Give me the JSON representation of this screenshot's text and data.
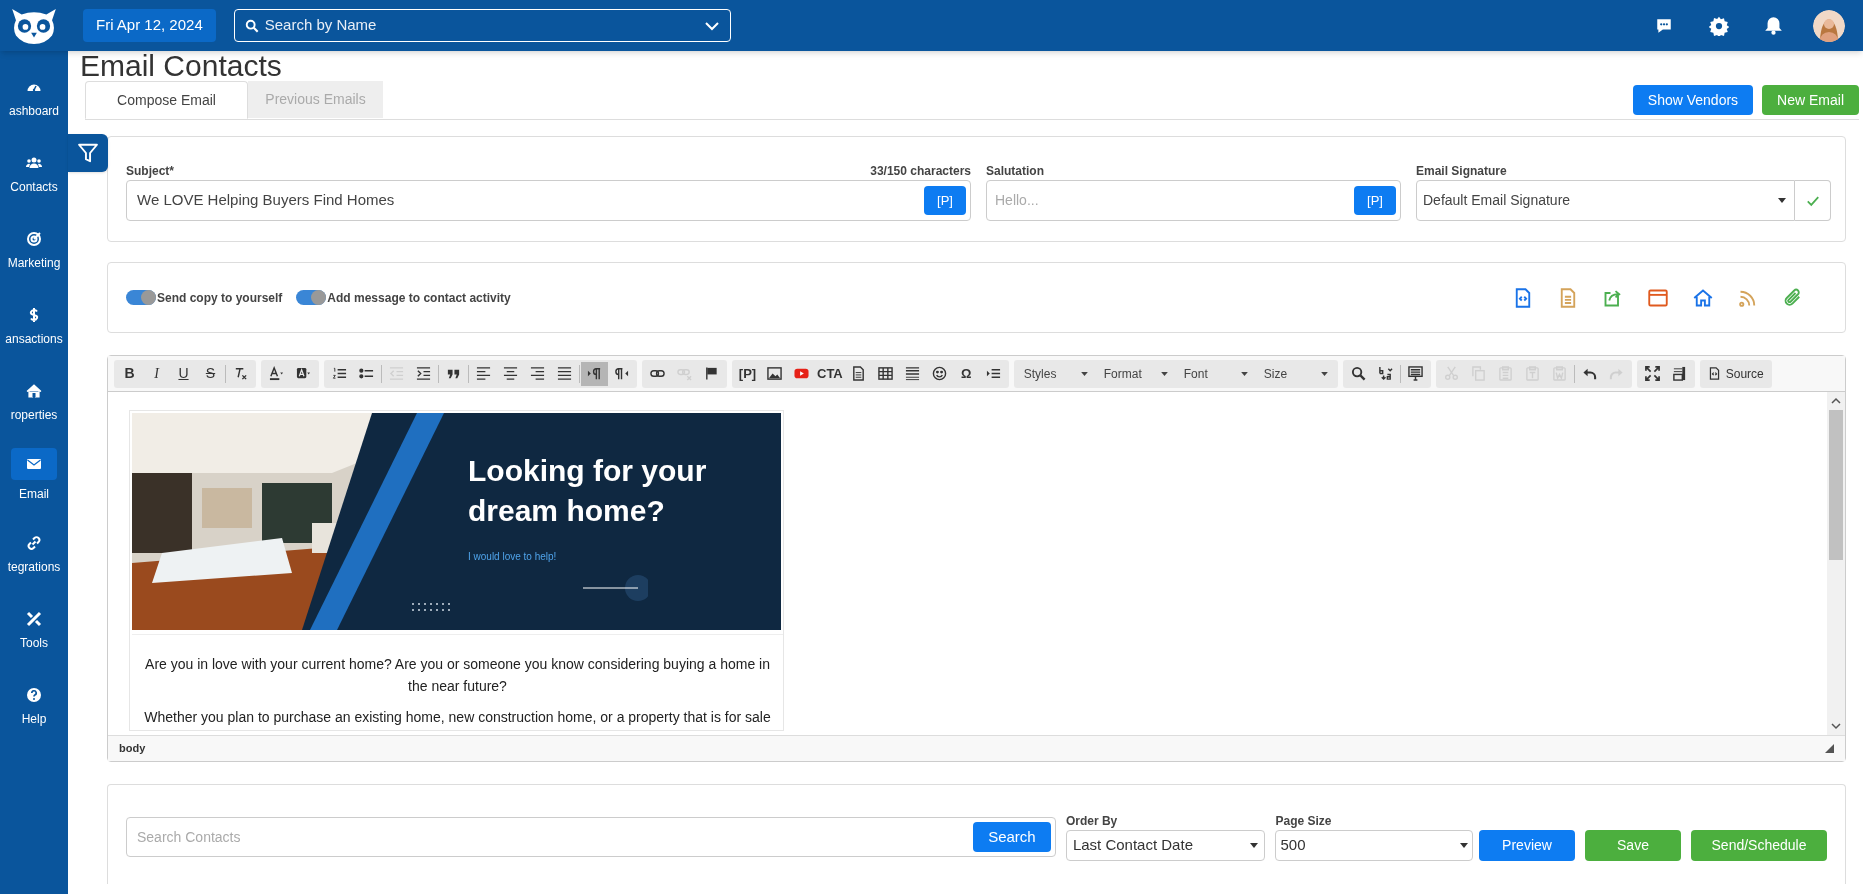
{
  "header": {
    "date": "Fri Apr 12, 2024",
    "search_placeholder": "Search by Name"
  },
  "sidebar": {
    "items": [
      {
        "label": "ashboard",
        "selected": false
      },
      {
        "label": "Contacts",
        "selected": false
      },
      {
        "label": "Marketing",
        "selected": false
      },
      {
        "label": "ansactions",
        "selected": false
      },
      {
        "label": "roperties",
        "selected": false
      },
      {
        "label": "Email",
        "selected": true
      },
      {
        "label": "tegrations",
        "selected": false
      },
      {
        "label": "Tools",
        "selected": false
      },
      {
        "label": "Help",
        "selected": false
      }
    ]
  },
  "page": {
    "title": "Email Contacts"
  },
  "tabs": [
    {
      "label": "Compose Email",
      "selected": true
    },
    {
      "label": "Previous Emails",
      "selected": false
    }
  ],
  "actions": [
    {
      "label": "Show Vendors",
      "kind": "primary"
    },
    {
      "label": "New Email",
      "kind": "success"
    }
  ],
  "compose": {
    "subject": {
      "label": "Subject*",
      "counter": "33/150 characters",
      "value": "We LOVE Helping Buyers Find Homes",
      "button": "[P]"
    },
    "salutation": {
      "label": "Salutation",
      "placeholder": "Hello...",
      "button": "[P]"
    },
    "signature": {
      "label": "Email Signature",
      "value": "Default Email Signature"
    }
  },
  "options": [
    {
      "label": "Send copy to yourself",
      "on": true
    },
    {
      "label": "Add message to contact activity",
      "on": true
    }
  ],
  "editor": {
    "toolbar": [
      [
        {
          "kind": "bold",
          "text": "B"
        },
        {
          "kind": "italic",
          "text": "I"
        },
        {
          "kind": "underline",
          "text": "U"
        },
        {
          "kind": "strike",
          "text": "S"
        },
        {
          "kind": "sep"
        },
        {
          "kind": "icon",
          "disabled": false
        }
      ],
      [
        {
          "kind": "icon",
          "disabled": false
        },
        {
          "kind": "icon",
          "disabled": false
        }
      ],
      [
        {
          "kind": "icon",
          "disabled": false
        },
        {
          "kind": "icon",
          "disabled": false
        },
        {
          "kind": "sep"
        },
        {
          "kind": "icon",
          "disabled": true
        },
        {
          "kind": "icon",
          "disabled": false
        },
        {
          "kind": "sep"
        },
        {
          "kind": "icon",
          "disabled": false
        },
        {
          "kind": "sep"
        },
        {
          "kind": "icon",
          "disabled": false
        },
        {
          "kind": "icon",
          "disabled": false
        },
        {
          "kind": "icon",
          "disabled": false
        },
        {
          "kind": "icon",
          "disabled": false
        },
        {
          "kind": "sep"
        },
        {
          "kind": "icon",
          "disabled": false,
          "selected": true
        },
        {
          "kind": "icon",
          "disabled": false,
          "selected": false
        }
      ],
      [
        {
          "kind": "icon",
          "disabled": false
        },
        {
          "kind": "icon",
          "disabled": true
        },
        {
          "kind": "icon",
          "disabled": false
        }
      ],
      [
        {
          "kind": "glyph",
          "text": "[P]"
        },
        {
          "kind": "icon",
          "disabled": false
        },
        {
          "kind": "icon",
          "disabled": false
        },
        {
          "kind": "glyph",
          "text": "CTA"
        },
        {
          "kind": "icon",
          "disabled": false
        },
        {
          "kind": "icon",
          "disabled": false
        },
        {
          "kind": "icon",
          "disabled": false
        },
        {
          "kind": "icon",
          "disabled": false
        },
        {
          "kind": "glyph",
          "text": "Ω"
        },
        {
          "kind": "icon",
          "disabled": false
        }
      ],
      [
        {
          "kind": "dropdown",
          "text": "Styles"
        },
        {
          "kind": "dropdown",
          "text": "Format"
        },
        {
          "kind": "dropdown",
          "text": "Font"
        },
        {
          "kind": "dropdown",
          "text": "Size"
        }
      ],
      [
        {
          "kind": "icon",
          "disabled": false
        },
        {
          "kind": "icon",
          "disabled": false
        },
        {
          "kind": "sep"
        },
        {
          "kind": "icon",
          "disabled": false
        }
      ],
      [
        {
          "kind": "icon",
          "disabled": true
        },
        {
          "kind": "icon",
          "disabled": true
        },
        {
          "kind": "icon",
          "disabled": true
        },
        {
          "kind": "icon",
          "disabled": true
        },
        {
          "kind": "icon",
          "disabled": true
        },
        {
          "kind": "sep"
        },
        {
          "kind": "icon",
          "disabled": false
        },
        {
          "kind": "icon",
          "disabled": true
        }
      ],
      [
        {
          "kind": "icon",
          "disabled": false
        },
        {
          "kind": "icon",
          "disabled": false
        }
      ],
      [
        {
          "kind": "button",
          "text": "Source"
        }
      ]
    ],
    "banner": {
      "heading": "Looking for your dream home?",
      "subheading": "I would love to help!"
    },
    "paragraphs": [
      "Are you in love with your current home? Are you or someone you know considering buying a home in the near future?",
      "Whether you plan to purchase an existing home, new construction home, or a property that is for sale"
    ],
    "path": "body"
  },
  "contacts": {
    "search_placeholder": "Search Contacts",
    "search_button": "Search",
    "order_by": {
      "label": "Order By",
      "value": "Last Contact Date"
    },
    "page_size": {
      "label": "Page Size",
      "value": "500"
    },
    "buttons": [
      {
        "label": "Preview",
        "kind": "primary"
      },
      {
        "label": "Save",
        "kind": "success"
      },
      {
        "label": "Send/Schedule",
        "kind": "success"
      }
    ]
  }
}
